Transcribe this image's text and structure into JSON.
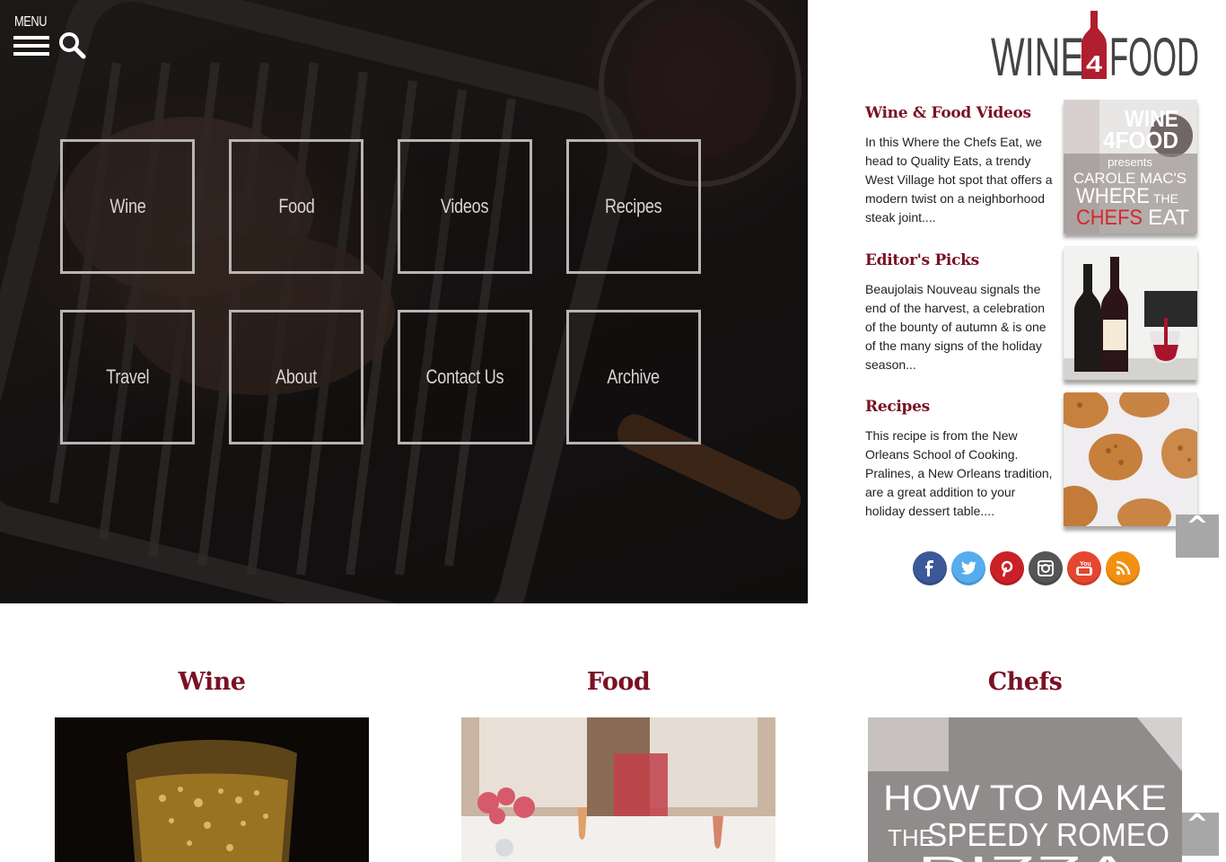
{
  "header": {
    "menu_label": "MENU"
  },
  "logo": {
    "text_left": "WINE",
    "text_num": "4",
    "text_right": "FOOD"
  },
  "nav_tiles": [
    {
      "label": "Wine"
    },
    {
      "label": "Food"
    },
    {
      "label": "Videos"
    },
    {
      "label": "Recipes"
    },
    {
      "label": "Travel"
    },
    {
      "label": "About"
    },
    {
      "label": "Contact Us"
    },
    {
      "label": "Archive"
    }
  ],
  "sidebar": {
    "items": [
      {
        "title": "Wine & Food Videos",
        "text": "In this Where the Chefs Eat, we head to Quality Eats, a trendy West Village hot spot that offers a modern twist on a neighborhood steak joint....",
        "thumb_lines": [
          "WINE",
          "4FOOD",
          "presents",
          "CAROLE MAC'S",
          "WHERE",
          "THE",
          "CHEFS",
          "EAT"
        ]
      },
      {
        "title": "Editor's Picks",
        "text": "Beaujolais Nouveau signals the end of the harvest, a celebration of the bounty of autumn & is one of the many signs of the holiday season..."
      },
      {
        "title": "Recipes",
        "text": "This recipe is from the New Orleans School of Cooking. Pralines, a New Orleans tradition, are a great addition to your holiday dessert table...."
      }
    ]
  },
  "social": [
    {
      "icon": "facebook-icon",
      "color": "#3b5998"
    },
    {
      "icon": "twitter-icon",
      "color": "#55acee"
    },
    {
      "icon": "pinterest-icon",
      "color": "#cb2027"
    },
    {
      "icon": "instagram-icon",
      "color": "#555555"
    },
    {
      "icon": "youtube-icon",
      "color": "#e5462f"
    },
    {
      "icon": "rss-icon",
      "color": "#f29111"
    }
  ],
  "back_to_top": {
    "label": "^"
  },
  "sections": [
    {
      "title": "Wine"
    },
    {
      "title": "Food"
    },
    {
      "title": "Chefs",
      "image_lines": [
        "HOW TO MAKE",
        "THE",
        "SPEEDY ROMEO",
        "PIZZA"
      ]
    }
  ],
  "colors": {
    "accent": "#7a1224",
    "logo_red": "#b01e2f",
    "logo_gray": "#444444"
  }
}
